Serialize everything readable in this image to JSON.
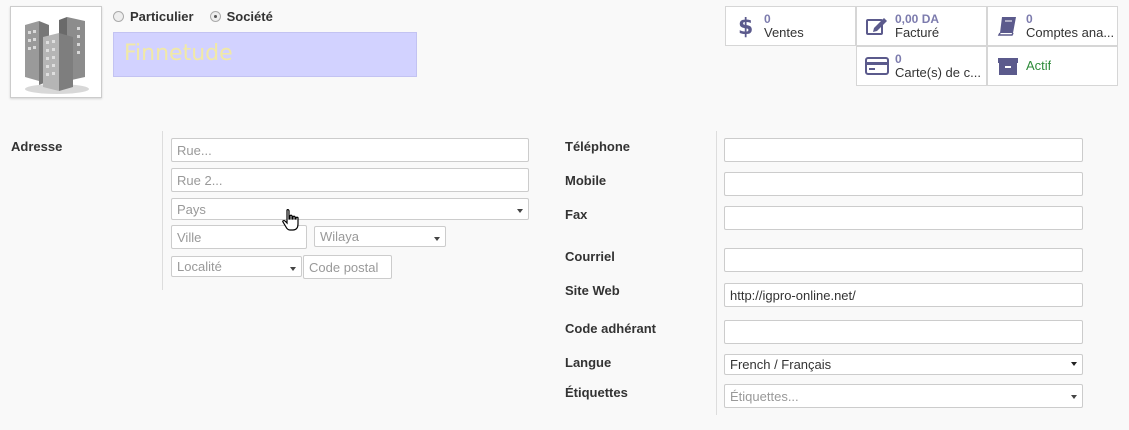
{
  "header": {
    "company_type": {
      "options": [
        {
          "label": "Particulier",
          "checked": false
        },
        {
          "label": "Société",
          "checked": true
        }
      ]
    },
    "name": "Finnetude",
    "avatar_icon": "building-icon"
  },
  "smart_buttons": [
    {
      "icon": "dollar-icon",
      "value": "0",
      "label": "Ventes"
    },
    {
      "icon": "edit-icon",
      "value": "0,00 DA",
      "label": "Facturé"
    },
    {
      "icon": "book-icon",
      "value": "0",
      "label": "Comptes ana..."
    },
    {
      "icon": "credit-card-icon",
      "value": "0",
      "label": "Carte(s) de c..."
    },
    {
      "icon": "archive-icon",
      "value": "",
      "label": "Actif"
    }
  ],
  "address": {
    "label": "Adresse",
    "street_placeholder": "Rue...",
    "street2_placeholder": "Rue 2...",
    "country_placeholder": "Pays",
    "city_placeholder": "Ville",
    "state_placeholder": "Wilaya",
    "locality_placeholder": "Localité",
    "zip_placeholder": "Code postal"
  },
  "contact": {
    "phone_label": "Téléphone",
    "mobile_label": "Mobile",
    "fax_label": "Fax",
    "email_label": "Courriel",
    "website_label": "Site Web",
    "website_value": "http://igpro-online.net/",
    "member_code_label": "Code adhérant",
    "language_label": "Langue",
    "language_value": "French / Français",
    "tags_label": "Étiquettes",
    "tags_placeholder": "Étiquettes..."
  },
  "colors": {
    "name_field_bg": "#d2d2ff",
    "name_text": "#f1e9a6",
    "smart_value": "#7c7bad",
    "active_green": "#2e8b3a"
  }
}
